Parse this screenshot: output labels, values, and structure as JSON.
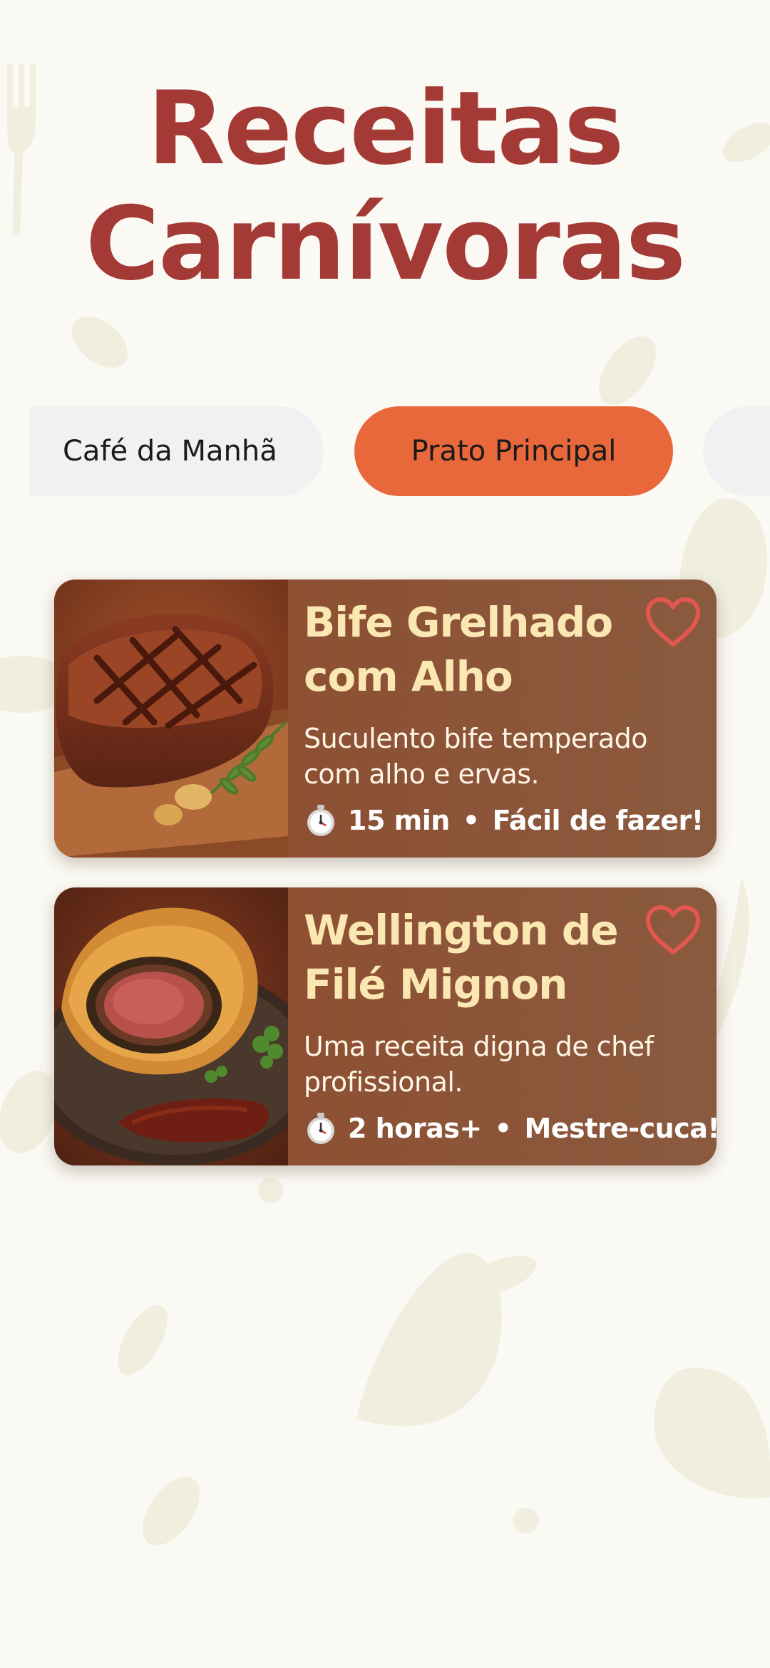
{
  "header": {
    "title_line1": "Receitas",
    "title_line2": "Carnívoras"
  },
  "tabs": [
    {
      "label": "Café da Manhã",
      "active": false
    },
    {
      "label": "Prato Principal",
      "active": true
    },
    {
      "label": "",
      "active": false
    }
  ],
  "recipes": [
    {
      "title": "Bife Grelhado com Alho",
      "description": "Suculento bife temperado com alho e ervas.",
      "time": "15 min",
      "difficulty": "Fácil de fazer!",
      "image": "grilled-steak",
      "favorite_icon": "heart-outline-icon"
    },
    {
      "title": "Wellington de Filé Mignon",
      "description": "Uma receita digna de chef profissional.",
      "time": "2 horas+",
      "difficulty": "Mestre-cuca!",
      "image": "beef-wellington",
      "favorite_icon": "heart-outline-icon"
    }
  ],
  "colors": {
    "background": "#faf9f3",
    "title": "#a43a36",
    "tab_active": "#e9683b",
    "tab_inactive": "#f1f1f4",
    "card": "#8f4a2c",
    "card_title": "#fbe7b2",
    "heart": "#e4574f"
  }
}
